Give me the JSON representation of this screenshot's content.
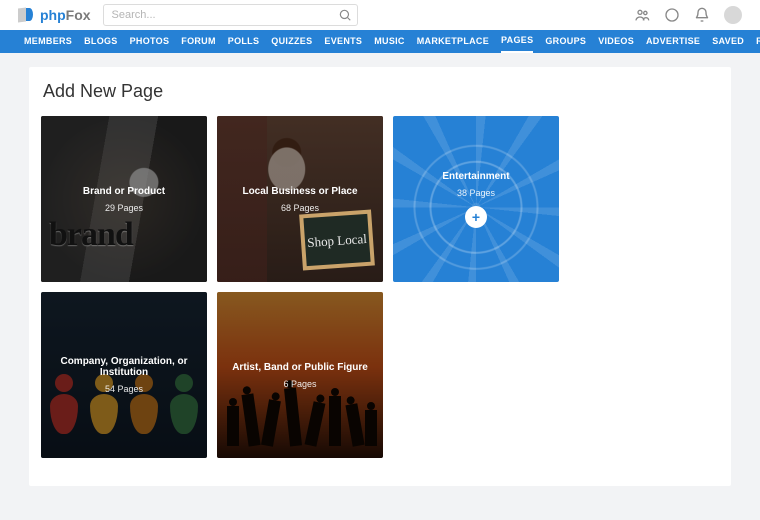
{
  "brand": {
    "part1": "php",
    "part2": "Fox"
  },
  "search": {
    "placeholder": "Search..."
  },
  "nav": {
    "items": [
      "MEMBERS",
      "BLOGS",
      "PHOTOS",
      "FORUM",
      "POLLS",
      "QUIZZES",
      "EVENTS",
      "MUSIC",
      "MARKETPLACE",
      "PAGES",
      "GROUPS",
      "VIDEOS",
      "ADVERTISE",
      "SAVED",
      "REWARDS"
    ],
    "active_index": 9
  },
  "page": {
    "title": "Add New Page"
  },
  "categories": [
    {
      "title": "Brand or Product",
      "sub": "29 Pages"
    },
    {
      "title": "Local Business or Place",
      "sub": "68 Pages"
    },
    {
      "title": "Entertainment",
      "sub": "38 Pages",
      "has_add": true
    },
    {
      "title": "Company, Organization, or Institution",
      "sub": "54 Pages"
    },
    {
      "title": "Artist, Band or Public Figure",
      "sub": "6 Pages"
    }
  ],
  "chalk_text": "Shop Local",
  "plus": "+"
}
